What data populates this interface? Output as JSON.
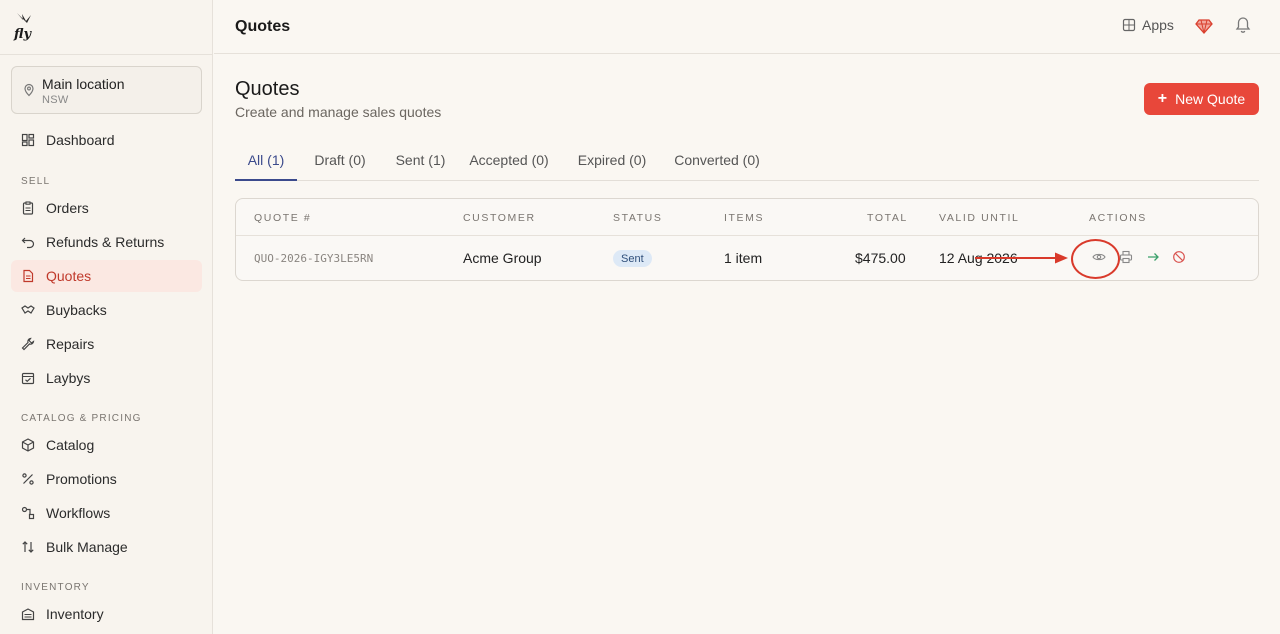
{
  "app": {
    "logo_text": "fly"
  },
  "sidebar": {
    "location": {
      "name": "Main location",
      "sub": "NSW"
    },
    "items": [
      {
        "label": "Dashboard",
        "icon": "dashboard-icon"
      },
      {
        "label": "Orders",
        "icon": "clipboard-icon"
      },
      {
        "label": "Refunds & Returns",
        "icon": "return-icon"
      },
      {
        "label": "Quotes",
        "icon": "document-icon",
        "active": true
      },
      {
        "label": "Buybacks",
        "icon": "handshake-icon"
      },
      {
        "label": "Repairs",
        "icon": "wrench-icon"
      },
      {
        "label": "Laybys",
        "icon": "calendar-check-icon"
      },
      {
        "label": "Catalog",
        "icon": "box-icon"
      },
      {
        "label": "Promotions",
        "icon": "percent-icon"
      },
      {
        "label": "Workflows",
        "icon": "workflow-icon"
      },
      {
        "label": "Bulk Manage",
        "icon": "sort-arrows-icon"
      },
      {
        "label": "Inventory",
        "icon": "warehouse-icon"
      }
    ],
    "sections": {
      "sell": "SELL",
      "catalog": "CATALOG & PRICING",
      "inventory": "INVENTORY"
    }
  },
  "topbar": {
    "title": "Quotes",
    "apps_label": "Apps"
  },
  "main": {
    "title": "Quotes",
    "subtitle": "Create and manage sales quotes",
    "new_button": "New Quote",
    "tabs": [
      {
        "label": "All (1)",
        "active": true
      },
      {
        "label": "Draft (0)"
      },
      {
        "label": "Sent (1)"
      },
      {
        "label": "Accepted (0)"
      },
      {
        "label": "Expired (0)"
      },
      {
        "label": "Converted (0)"
      }
    ],
    "table": {
      "headers": [
        "QUOTE #",
        "CUSTOMER",
        "STATUS",
        "ITEMS",
        "TOTAL",
        "VALID UNTIL",
        "ACTIONS"
      ],
      "rows": [
        {
          "quote_no": "QUO-2026-IGY3LE5RN",
          "customer": "Acme Group",
          "status": "Sent",
          "items": "1 item",
          "total": "$475.00",
          "valid_until": "12 Aug 2026"
        }
      ]
    }
  },
  "colors": {
    "accent": "#e8473a",
    "tab_active": "#3b4a8c",
    "annotation": "#d93a2b"
  }
}
